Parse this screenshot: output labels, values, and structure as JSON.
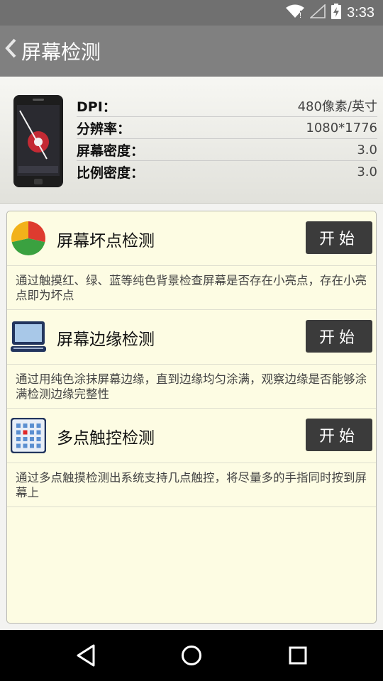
{
  "status_bar": {
    "time": "3:33",
    "icons": [
      "wifi-icon",
      "signal-icon",
      "battery-charging-icon"
    ]
  },
  "header": {
    "back_icon": "chevron-left-icon",
    "title": "屏幕检测"
  },
  "device_info": {
    "image": "phone-icon",
    "rows": [
      {
        "label": "DPI：",
        "value": "480像素/英寸"
      },
      {
        "label": "分辨率：",
        "value": "1080*1776"
      },
      {
        "label": "屏幕密度：",
        "value": "3.0"
      },
      {
        "label": "比例密度：",
        "value": "3.0"
      }
    ]
  },
  "tests": [
    {
      "icon": "pie-chart-icon",
      "title": "屏幕坏点检测",
      "button": "开始",
      "description": "通过触摸红、绿、蓝等纯色背景检查屏幕是否存在小亮点，存在小亮点即为坏点"
    },
    {
      "icon": "laptop-icon",
      "title": "屏幕边缘检测",
      "button": "开始",
      "description": "通过用纯色涂抹屏幕边缘，直到边缘均匀涂满，观察边缘是否能够涂满检测边缘完整性"
    },
    {
      "icon": "grid-dots-icon",
      "title": "多点触控检测",
      "button": "开始",
      "description": "通过多点触摸检测出系统支持几点触控，将尽量多的手指同时按到屏幕上"
    }
  ],
  "nav_bar": {
    "buttons": [
      "back-triangle-icon",
      "home-circle-icon",
      "recents-square-icon"
    ]
  }
}
